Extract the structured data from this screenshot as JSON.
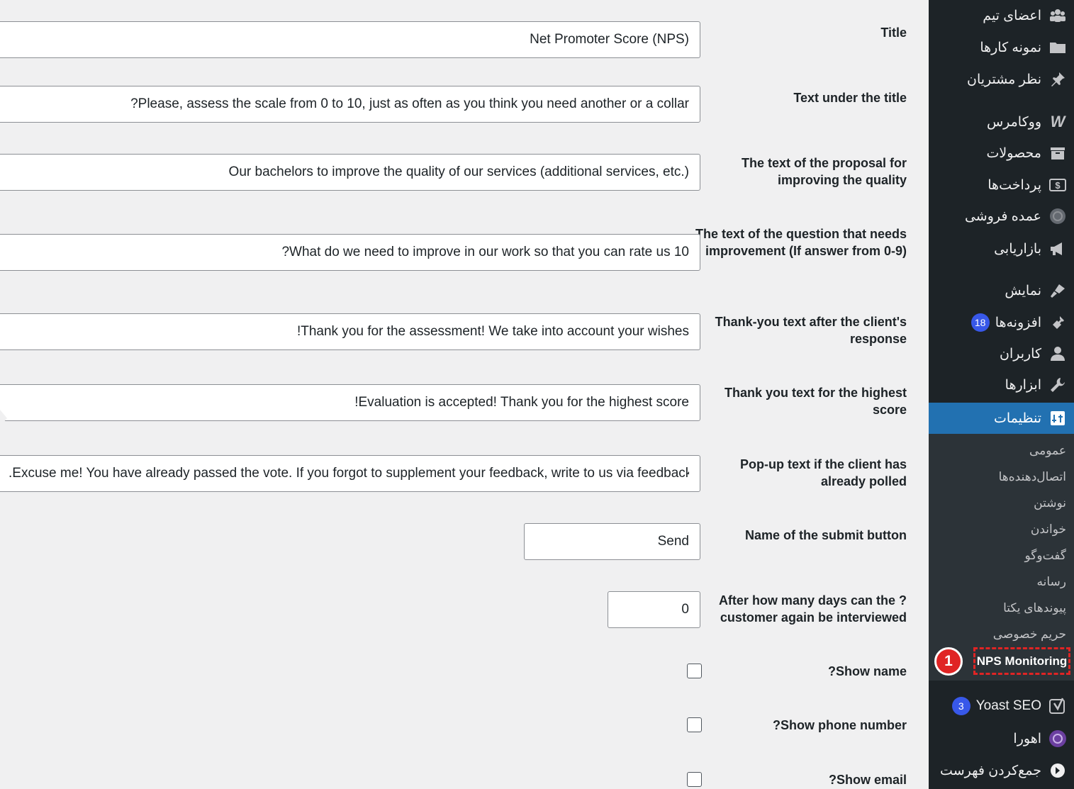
{
  "form": {
    "rows": [
      {
        "id": "title",
        "label": "Title",
        "value": "Net Promoter Score (NPS)"
      },
      {
        "id": "subtitle",
        "label": "Text under the title",
        "value": "?Please, assess the scale from 0 to 10, just as often as you think you need another or a collar"
      },
      {
        "id": "proposal",
        "label": "The text of the proposal for improving the quality",
        "value": "Our bachelors to improve the quality of our services (additional services, etc.)"
      },
      {
        "id": "improve_q",
        "label": "The text of the question that needs improvement (If answer from 0-9)",
        "value": "?What do we need to improve in our work so that you can rate us 10"
      },
      {
        "id": "thanks",
        "label": "Thank-you text after the client's response",
        "value": "!Thank you for the assessment! We take into account your wishes"
      },
      {
        "id": "thanks_high",
        "label": "Thank you text for the highest score",
        "value": "!Evaluation is accepted! Thank you for the highest score"
      },
      {
        "id": "popup",
        "label": "Pop-up text if the client has already polled",
        "value": ".Excuse me! You have already passed the vote. If you forgot to supplement your feedback, write to us via feedback"
      },
      {
        "id": "submit_name",
        "label": "Name of the submit button",
        "value": "Send"
      },
      {
        "id": "days",
        "label": "After how many days can the ?customer again be interviewed",
        "value": "0"
      }
    ],
    "checkboxes": [
      {
        "id": "show_name",
        "label": "?Show name",
        "checked": false
      },
      {
        "id": "show_phone",
        "label": "?Show phone number",
        "checked": false
      },
      {
        "id": "show_email",
        "label": "?Show email",
        "checked": false
      }
    ]
  },
  "sidebar": {
    "items": [
      {
        "id": "team",
        "label": "اعضای تیم",
        "icon": "groups-icon"
      },
      {
        "id": "portfolio",
        "label": "نمونه کارها",
        "icon": "folder-icon"
      },
      {
        "id": "testimonials",
        "label": "نظر مشتریان",
        "icon": "pin-icon"
      },
      {
        "id": "woocommerce",
        "label": "ووکامرس",
        "icon": "woocommerce-icon"
      },
      {
        "id": "products",
        "label": "محصولات",
        "icon": "archive-icon"
      },
      {
        "id": "payments",
        "label": "پرداخت‌ها",
        "icon": "money-icon"
      },
      {
        "id": "wholesale",
        "label": "عمده فروشی",
        "icon": "wholesale-icon"
      },
      {
        "id": "marketing",
        "label": "بازاریابی",
        "icon": "megaphone-icon"
      },
      {
        "id": "appearance",
        "label": "نمایش",
        "icon": "brush-icon"
      },
      {
        "id": "plugins",
        "label": "افزونه‌ها",
        "icon": "plugin-icon",
        "badge": "18"
      },
      {
        "id": "users",
        "label": "کاربران",
        "icon": "user-icon"
      },
      {
        "id": "tools",
        "label": "ابزارها",
        "icon": "wrench-icon"
      }
    ],
    "active": {
      "label": "تنظیمات",
      "icon": "settings-icon"
    },
    "submenu": [
      "عمومی",
      "اتصال‌دهنده‌ها",
      "نوشتن",
      "خواندن",
      "گفت‌وگو",
      "رسانه",
      "پیوندهای یکتا",
      "حریم خصوصی"
    ],
    "highlighted_submenu": "NPS Monitoring",
    "step_number": "1",
    "bottom_items": [
      {
        "id": "yoast",
        "label": "Yoast SEO",
        "icon": "yoast-icon",
        "badge": "3"
      },
      {
        "id": "ahora",
        "label": "اهورا",
        "icon": "ahora-icon"
      },
      {
        "id": "collapse",
        "label": "جمع‌کردن فهرست",
        "icon": "collapse-icon"
      }
    ]
  },
  "colors": {
    "sidebar_bg": "#1d2327",
    "submenu_bg": "#2c3338",
    "active_bg": "#2271b1",
    "badge": "#3858e9",
    "highlight": "#e02424",
    "page_bg": "#f0f0f1"
  }
}
